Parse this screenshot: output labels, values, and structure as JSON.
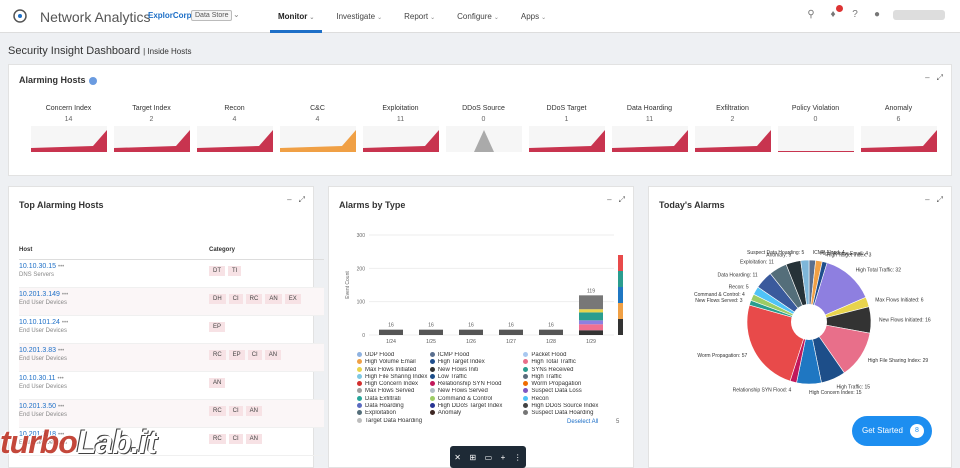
{
  "app": {
    "title": "Network Analytics",
    "tenant": "ExplorCorp",
    "store": "Data Store"
  },
  "nav": [
    {
      "label": "Monitor",
      "active": true
    },
    {
      "label": "Investigate"
    },
    {
      "label": "Report"
    },
    {
      "label": "Configure"
    },
    {
      "label": "Apps"
    }
  ],
  "page": {
    "title": "Security Insight Dashboard",
    "subtitle": "Inside Hosts"
  },
  "alarming_hosts": {
    "title": "Alarming Hosts",
    "metrics": [
      {
        "label": "Concern Index",
        "value": "14",
        "color": "#c8344f"
      },
      {
        "label": "Target Index",
        "value": "2",
        "color": "#c8344f"
      },
      {
        "label": "Recon",
        "value": "4",
        "color": "#c8344f"
      },
      {
        "label": "C&C",
        "value": "4",
        "color": "#f0a045"
      },
      {
        "label": "Exploitation",
        "value": "11",
        "color": "#c8344f"
      },
      {
        "label": "DDoS Source",
        "value": "0",
        "color": "#aaaaaa"
      },
      {
        "label": "DDoS Target",
        "value": "1",
        "color": "#c8344f"
      },
      {
        "label": "Data Hoarding",
        "value": "11",
        "color": "#c8344f"
      },
      {
        "label": "Exfiltration",
        "value": "2",
        "color": "#c8344f"
      },
      {
        "label": "Policy Violation",
        "value": "0",
        "color": "#c8344f"
      },
      {
        "label": "Anomaly",
        "value": "6",
        "color": "#c8344f"
      }
    ]
  },
  "top_hosts": {
    "title": "Top Alarming Hosts",
    "col_host": "Host",
    "col_category": "Category",
    "rows": [
      {
        "ip": "10.10.30.15",
        "group": "DNS Servers",
        "cats": [
          "DT",
          "TI"
        ]
      },
      {
        "ip": "10.201.3.149",
        "group": "End User Devices",
        "cats": [
          "DH",
          "CI",
          "RC",
          "AN",
          "EX"
        ]
      },
      {
        "ip": "10.10.101.24",
        "group": "End User Devices",
        "cats": [
          "EP"
        ]
      },
      {
        "ip": "10.201.3.83",
        "group": "End User Devices",
        "cats": [
          "RC",
          "EP",
          "CI",
          "AN"
        ]
      },
      {
        "ip": "10.10.30.11",
        "group": "End User Devices",
        "cats": [
          "AN"
        ]
      },
      {
        "ip": "10.201.3.50",
        "group": "End User Devices",
        "cats": [
          "RC",
          "CI",
          "AN"
        ]
      },
      {
        "ip": "10.201.3.18",
        "group": "End User Devices",
        "cats": [
          "RC",
          "CI",
          "AN"
        ]
      }
    ]
  },
  "alarms_by_type": {
    "title": "Alarms by Type",
    "deselect": "Deselect All",
    "pager": "5",
    "legend": [
      {
        "label": "UDP Flood",
        "color": "#8fb2e0"
      },
      {
        "label": "ICMP Flood",
        "color": "#5a6f8f"
      },
      {
        "label": "Packet Flood",
        "color": "#a8c8f0"
      },
      {
        "label": "High Volume Email",
        "color": "#f0a045"
      },
      {
        "label": "High Target Index",
        "color": "#1f4e8c"
      },
      {
        "label": "High Total Traffic",
        "color": "#e86f8a"
      },
      {
        "label": "Max Flows Initiated",
        "color": "#e8d44d"
      },
      {
        "label": "New Flows Initi",
        "color": "#333333"
      },
      {
        "label": "SYNs Received",
        "color": "#2a9d8f"
      },
      {
        "label": "High File Sharing Index",
        "color": "#7ec8e3"
      },
      {
        "label": "Low Traffic",
        "color": "#1d4e89"
      },
      {
        "label": "High Traffic",
        "color": "#5b6b7b"
      },
      {
        "label": "High Concern Index",
        "color": "#d32f2f"
      },
      {
        "label": "Relationship SYN Flood",
        "color": "#c2185b"
      },
      {
        "label": "Worm Propagation",
        "color": "#ef6c00"
      },
      {
        "label": "Max Flows Served",
        "color": "#9e9e9e"
      },
      {
        "label": "New Flows Served",
        "color": "#b0bec5"
      },
      {
        "label": "Suspect Data Loss",
        "color": "#7e57c2"
      },
      {
        "label": "Data Exfiltrati",
        "color": "#26a69a"
      },
      {
        "label": "Command & Control",
        "color": "#9ccc65"
      },
      {
        "label": "Recon",
        "color": "#4fc3f7"
      },
      {
        "label": "Data Hoarding",
        "color": "#5c6bc0"
      },
      {
        "label": "High DDoS Target Index",
        "color": "#283593"
      },
      {
        "label": "High DDoS Source Index",
        "color": "#424242"
      },
      {
        "label": "Exploitation",
        "color": "#546e7a"
      },
      {
        "label": "Anomaly",
        "color": "#3e2723"
      },
      {
        "label": "Suspect Data Hoarding",
        "color": "#757575"
      },
      {
        "label": "Target Data Hoarding",
        "color": "#bdbdbd"
      }
    ]
  },
  "chart_data": [
    {
      "type": "bar",
      "title": "Alarms by Type",
      "ylabel": "Event Count",
      "categories": [
        "1/24",
        "1/25",
        "1/26",
        "1/27",
        "1/28",
        "1/29"
      ],
      "values": [
        16,
        16,
        16,
        16,
        16,
        119
      ],
      "yticks": [
        0,
        100,
        200,
        300
      ],
      "ylim": [
        0,
        300
      ]
    },
    {
      "type": "pie",
      "title": "Today's Alarms",
      "slices": [
        {
          "label": "ICMP Flood",
          "value": 4,
          "color": "#5a6f8f"
        },
        {
          "label": "High Volume Email",
          "value": 4,
          "color": "#f0a045"
        },
        {
          "label": "High Target Index",
          "value": 3,
          "color": "#1f4e8c"
        },
        {
          "label": "High Total Traffic",
          "value": 32,
          "color": "#8e7fe0"
        },
        {
          "label": "Max Flows Initiated",
          "value": 6,
          "color": "#e8d44d"
        },
        {
          "label": "New Flows Initiated",
          "value": 16,
          "color": "#333333"
        },
        {
          "label": "High File Sharing Index",
          "value": 29,
          "color": "#e86f8a"
        },
        {
          "label": "High Traffic",
          "value": 15,
          "color": "#1d4e89"
        },
        {
          "label": "High Concern Index",
          "value": 15,
          "color": "#1f77c2"
        },
        {
          "label": "Relationship SYN Flood",
          "value": 4,
          "color": "#c2185b"
        },
        {
          "label": "Worm Propagation",
          "value": 57,
          "color": "#e84a4a"
        },
        {
          "label": "New Flows Served",
          "value": 3,
          "color": "#2a9d8f"
        },
        {
          "label": "Command & Control",
          "value": 4,
          "color": "#9ccc65"
        },
        {
          "label": "Recon",
          "value": 5,
          "color": "#4fc3f7"
        },
        {
          "label": "Data Hoarding",
          "value": 11,
          "color": "#3a5a9c"
        },
        {
          "label": "Exploitation",
          "value": 11,
          "color": "#546e7a"
        },
        {
          "label": "Anomaly",
          "value": 9,
          "color": "#263238"
        },
        {
          "label": "Suspect Data Hoarding",
          "value": 5,
          "color": "#7eb6d9"
        }
      ]
    }
  ],
  "todays_alarms": {
    "title": "Today's Alarms"
  },
  "get_started": {
    "label": "Get Started",
    "count": "8"
  },
  "watermark": {
    "part1": "turbo",
    "part2": "Lab.it"
  }
}
